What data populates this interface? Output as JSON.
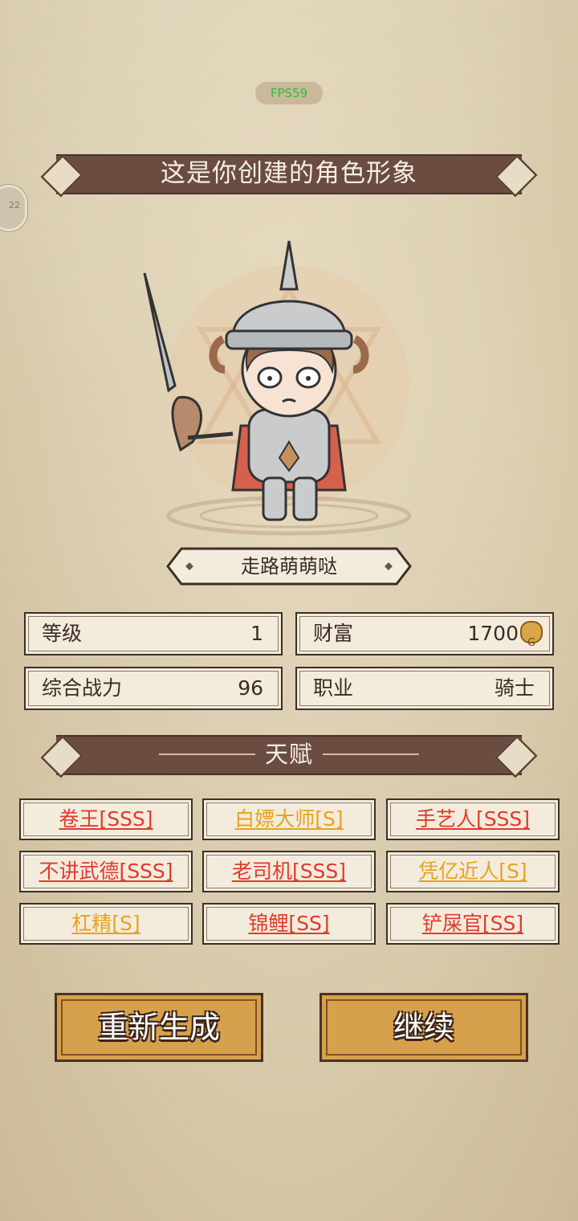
{
  "fps_label": "FPS59",
  "side_bubble_text": "22",
  "header": {
    "title": "这是你创建的角色形象"
  },
  "character": {
    "name": "走路萌萌哒"
  },
  "stats": {
    "level": {
      "label": "等级",
      "value": "1"
    },
    "wealth": {
      "label": "财富",
      "value": "1700"
    },
    "power": {
      "label": "综合战力",
      "value": "96"
    },
    "job": {
      "label": "职业",
      "value": "骑士"
    }
  },
  "talents_header": {
    "title": "天赋"
  },
  "talents": [
    {
      "label": "卷王[SSS]",
      "color": "#e23a2a"
    },
    {
      "label": "白嫖大师[S]",
      "color": "#e8a21c"
    },
    {
      "label": "手艺人[SSS]",
      "color": "#e23a2a"
    },
    {
      "label": "不讲武德[SSS]",
      "color": "#e23a2a"
    },
    {
      "label": "老司机[SSS]",
      "color": "#e23a2a"
    },
    {
      "label": "凭亿近人[S]",
      "color": "#e8a21c"
    },
    {
      "label": "杠精[S]",
      "color": "#e8a21c"
    },
    {
      "label": "锦鲤[SS]",
      "color": "#e23a2a"
    },
    {
      "label": "铲屎官[SS]",
      "color": "#e23a2a"
    }
  ],
  "buttons": {
    "regenerate": "重新生成",
    "continue": "继续"
  },
  "colors": {
    "banner": "#6a4c40",
    "button": "#d6a04c",
    "red": "#e23a2a",
    "gold": "#e8a21c"
  }
}
